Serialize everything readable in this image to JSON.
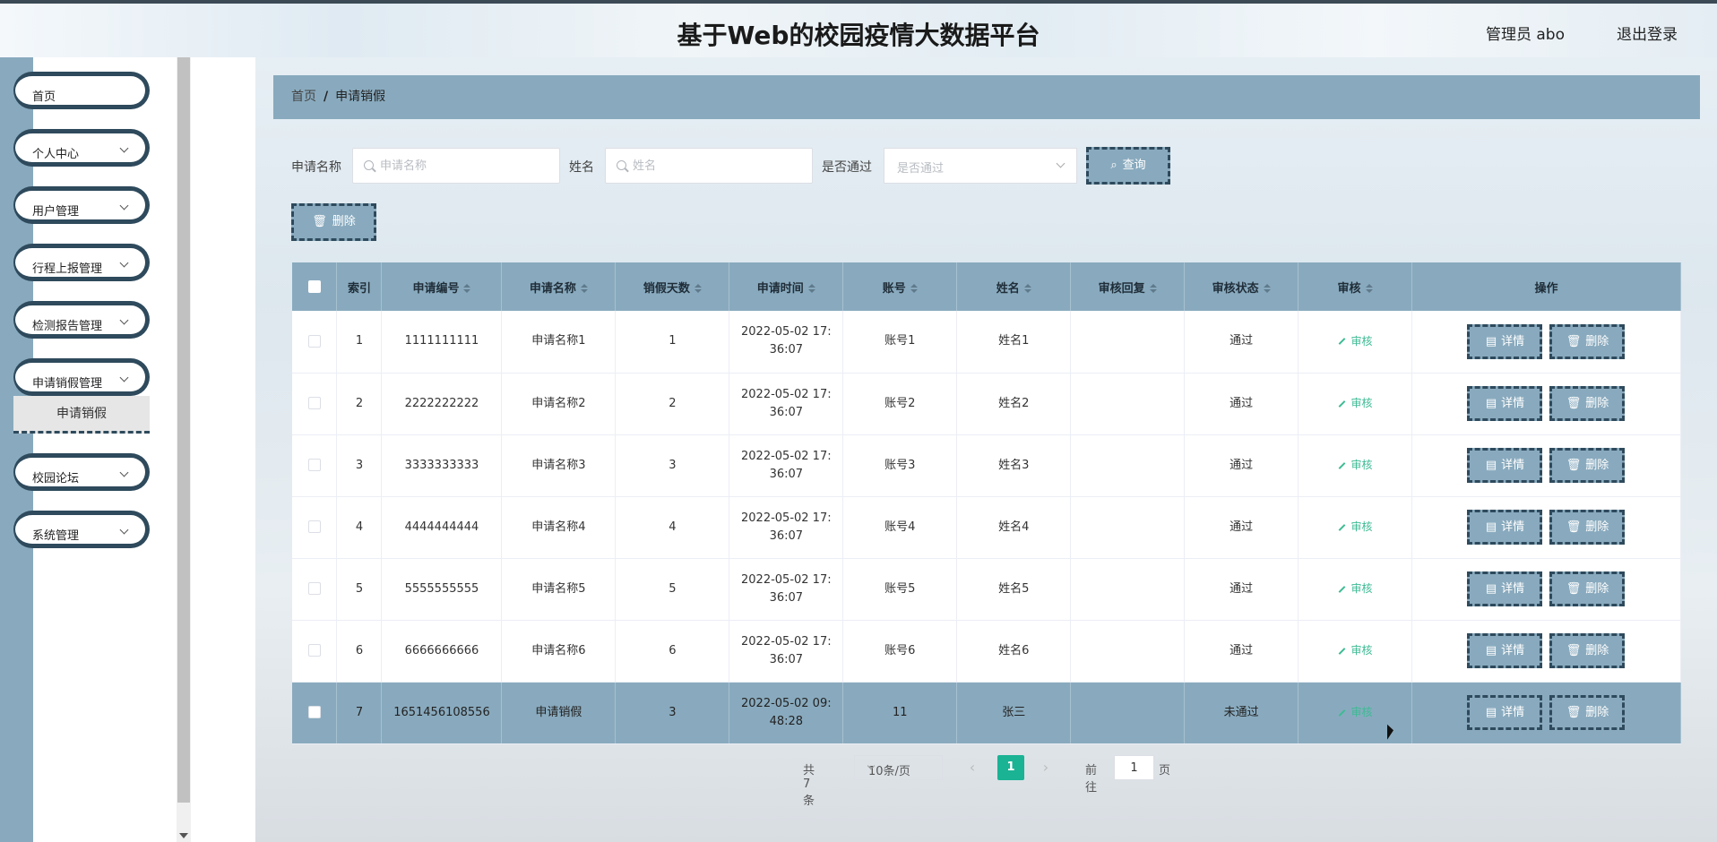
{
  "header": {
    "title": "基于Web的校园疫情大数据平台",
    "admin": "管理员 abo",
    "logout": "退出登录"
  },
  "sidebar": {
    "items": [
      {
        "label": "首页",
        "expandable": false
      },
      {
        "label": "个人中心",
        "expandable": true
      },
      {
        "label": "用户管理",
        "expandable": true
      },
      {
        "label": "行程上报管理",
        "expandable": true
      },
      {
        "label": "检测报告管理",
        "expandable": true
      },
      {
        "label": "申请销假管理",
        "expandable": true
      },
      {
        "label": "校园论坛",
        "expandable": true
      },
      {
        "label": "系统管理",
        "expandable": true
      }
    ],
    "active_sub": "申请销假"
  },
  "breadcrumb": {
    "home": "首页",
    "sep": "/",
    "current": "申请销假"
  },
  "search": {
    "name_label": "申请名称",
    "name_placeholder": "申请名称",
    "xingming_label": "姓名",
    "xingming_placeholder": "姓名",
    "passed_label": "是否通过",
    "passed_placeholder": "是否通过",
    "query_button": "查询"
  },
  "actions": {
    "delete_button": "删除"
  },
  "table": {
    "columns": [
      "索引",
      "申请编号",
      "申请名称",
      "销假天数",
      "申请时间",
      "账号",
      "姓名",
      "审核回复",
      "审核状态",
      "审核",
      "操作"
    ],
    "audit_label": "审核",
    "detail_label": "详情",
    "delete_label": "删除",
    "rows": [
      {
        "index": "1",
        "code": "1111111111",
        "name": "申请名称1",
        "days": "1",
        "time_a": "2022-05-02 17:",
        "time_b": "36:07",
        "account": "账号1",
        "xingming": "姓名1",
        "reply": "",
        "status": "通过"
      },
      {
        "index": "2",
        "code": "2222222222",
        "name": "申请名称2",
        "days": "2",
        "time_a": "2022-05-02 17:",
        "time_b": "36:07",
        "account": "账号2",
        "xingming": "姓名2",
        "reply": "",
        "status": "通过"
      },
      {
        "index": "3",
        "code": "3333333333",
        "name": "申请名称3",
        "days": "3",
        "time_a": "2022-05-02 17:",
        "time_b": "36:07",
        "account": "账号3",
        "xingming": "姓名3",
        "reply": "",
        "status": "通过"
      },
      {
        "index": "4",
        "code": "4444444444",
        "name": "申请名称4",
        "days": "4",
        "time_a": "2022-05-02 17:",
        "time_b": "36:07",
        "account": "账号4",
        "xingming": "姓名4",
        "reply": "",
        "status": "通过"
      },
      {
        "index": "5",
        "code": "5555555555",
        "name": "申请名称5",
        "days": "5",
        "time_a": "2022-05-02 17:",
        "time_b": "36:07",
        "account": "账号5",
        "xingming": "姓名5",
        "reply": "",
        "status": "通过"
      },
      {
        "index": "6",
        "code": "6666666666",
        "name": "申请名称6",
        "days": "6",
        "time_a": "2022-05-02 17:",
        "time_b": "36:07",
        "account": "账号6",
        "xingming": "姓名6",
        "reply": "",
        "status": "通过"
      },
      {
        "index": "7",
        "code": "1651456108556",
        "name": "申请销假",
        "days": "3",
        "time_a": "2022-05-02 09:",
        "time_b": "48:28",
        "account": "11",
        "xingming": "张三",
        "reply": "",
        "status": "未通过"
      }
    ]
  },
  "pagination": {
    "total": "共 7 条",
    "page_size": "10条/页",
    "current": "1",
    "goto_label": "前往",
    "goto_value": "1",
    "page_label": "页"
  },
  "colors": {
    "accent": "#89aabe",
    "border_dark": "#2e4a5c",
    "page_active": "#1ab394",
    "audit_link": "#3dbb94"
  }
}
